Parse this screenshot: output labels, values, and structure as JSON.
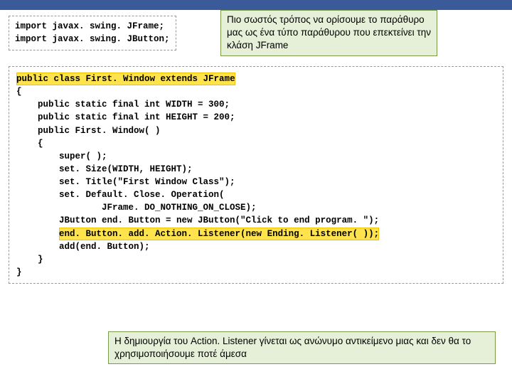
{
  "imports": {
    "line1": "import javax. swing. JFrame;",
    "line2": "import javax. swing. JButton;"
  },
  "callout_top": "Πιο σωστός τρόπος να ορίσουμε το παράθυρο μας ως ένα τύπο παράθυρου που επεκτείνει την κλάση JFrame",
  "code": {
    "l01a": "public class First. Window ",
    "l01b": "extends JFrame",
    "l02": "{",
    "l03": "    public static final int WIDTH = 300;",
    "l04": "    public static final int HEIGHT = 200;",
    "l05": "",
    "l06": "    public First. Window( )",
    "l07": "    {",
    "l08": "        super( );",
    "l09": "        set. Size(WIDTH, HEIGHT);",
    "l10": "",
    "l11": "        set. Title(\"First Window Class\");",
    "l12": "",
    "l13": "        set. Default. Close. Operation(",
    "l14": "                JFrame. DO_NOTHING_ON_CLOSE);",
    "l15": "",
    "l16": "        JButton end. Button = new JButton(\"Click to end program. \");",
    "l17a": "        ",
    "l17b": "end. Button. add. Action. Listener(new Ending. Listener( ));",
    "l18": "        add(end. Button);",
    "l19": "    }",
    "l20": "}"
  },
  "callout_bottom": "Η δημιουργία του Action. Listener γίνεται ως ανώνυμο αντικείμενο μιας και δεν θα το χρησιμοποιήσουμε ποτέ άμεσα"
}
